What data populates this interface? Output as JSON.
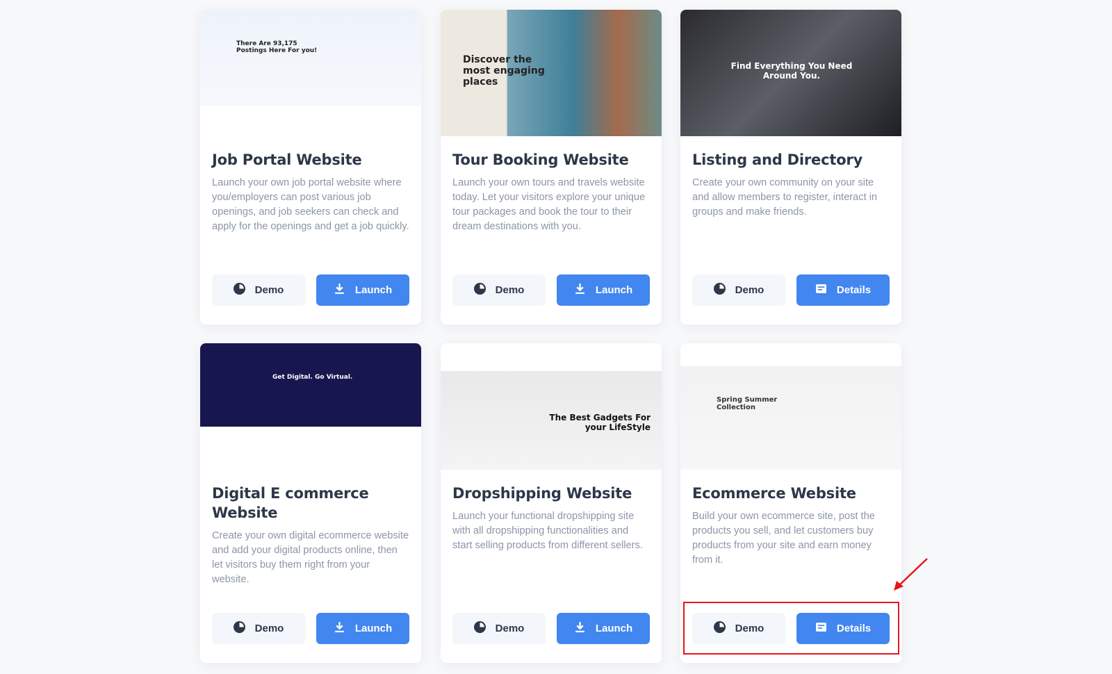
{
  "cards": [
    {
      "title": "Job Portal Website",
      "desc": "Launch your own job portal website where you/employers can post various job openings, and job seekers can check and apply for the openings and get a job quickly.",
      "demo": "Demo",
      "action": "Launch",
      "action_icon": "download-icon",
      "thumb_text": "There Are 93,175 Postings Here For you!"
    },
    {
      "title": "Tour Booking Website",
      "desc": "Launch your own tours and travels website today. Let your visitors explore your unique tour packages and book the tour to their dream destinations with you.",
      "demo": "Demo",
      "action": "Launch",
      "action_icon": "download-icon",
      "thumb_text": "Discover the most engaging places"
    },
    {
      "title": "Listing and Directory",
      "desc": "Create your own community on your site and allow members to register, interact in groups and make friends.",
      "demo": "Demo",
      "action": "Details",
      "action_icon": "document-icon",
      "thumb_text": "Find Everything You Need Around You."
    },
    {
      "title": "Digital E commerce Website",
      "desc": "Create your own digital ecommerce website and add your digital products online, then let visitors buy them right from your website.",
      "demo": "Demo",
      "action": "Launch",
      "action_icon": "download-icon",
      "thumb_text": "Get Digital. Go Virtual."
    },
    {
      "title": "Dropshipping Website",
      "desc": "Launch your functional dropshipping site with all dropshipping functionalities and start selling products from different sellers.",
      "demo": "Demo",
      "action": "Launch",
      "action_icon": "download-icon",
      "thumb_text": "The Best Gadgets For your LifeStyle"
    },
    {
      "title": "Ecommerce Website",
      "desc": "Build your own ecommerce site, post the products you sell, and let customers buy products from your site and earn money from it.",
      "demo": "Demo",
      "action": "Details",
      "action_icon": "document-icon",
      "thumb_text": "Spring Summer Collection"
    }
  ],
  "colors": {
    "primary": "#4286f0",
    "highlight": "#e8141a",
    "title": "#2d3748",
    "text": "#8b95a7"
  }
}
